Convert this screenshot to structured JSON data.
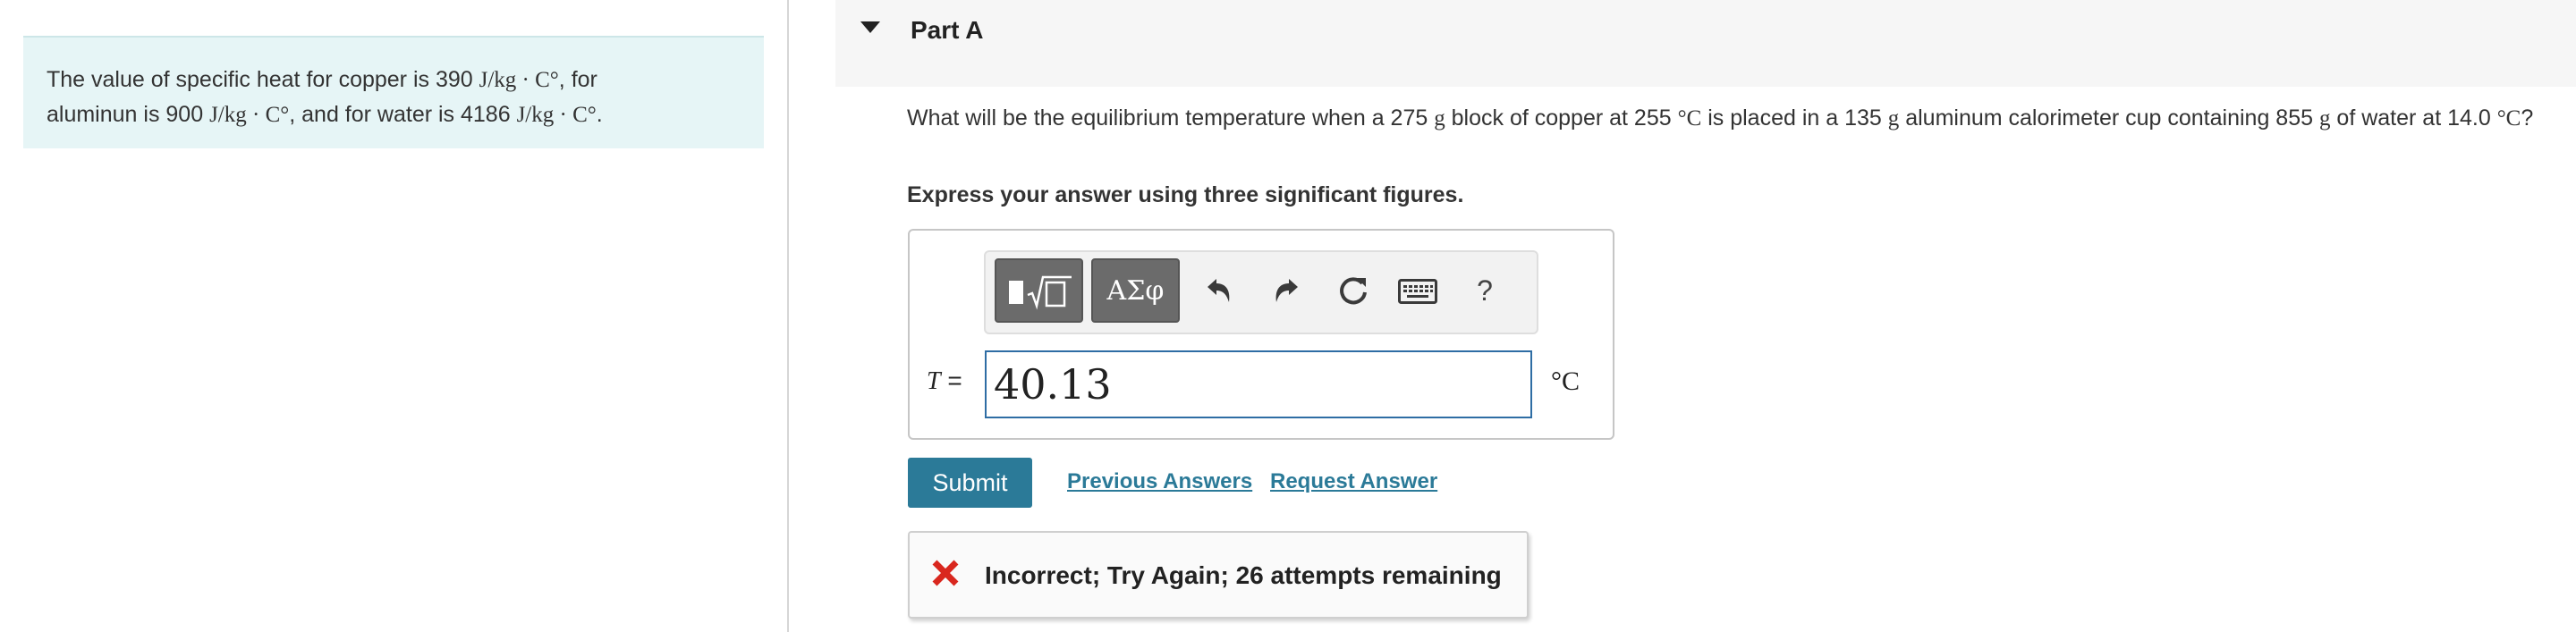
{
  "info": {
    "text_1": "The value of specific heat for copper is 390 ",
    "unit_jkgc": "J/kg · C°",
    "text_2": ", for",
    "text_3": "aluminun is 900 ",
    "text_4": ", and for water is 4186 ",
    "text_5": "."
  },
  "part": {
    "title": "Part A"
  },
  "question": {
    "text_1": "What will be the equilibrium temperature when a 275 ",
    "g": "g",
    "text_2": " block of copper at 255 ",
    "deg_c": "°C",
    "text_3": " is placed in a 135 ",
    "text_4": " aluminum calorimeter cup containing 855 ",
    "text_5": " of water at 14.0 ",
    "text_6": "?"
  },
  "instruction": "Express your answer using three significant figures.",
  "toolbar": {
    "greek_label": "ΑΣφ",
    "help_label": "?",
    "icons": [
      "templates-icon",
      "greek-letters-icon",
      "undo-icon",
      "redo-icon",
      "reset-icon",
      "keyboard-icon",
      "help-icon"
    ]
  },
  "answer": {
    "variable": "T",
    "equals": "=",
    "value": "40.13",
    "unit": "°C"
  },
  "actions": {
    "submit_label": "Submit",
    "previous_answers_label": "Previous Answers",
    "request_answer_label": "Request Answer"
  },
  "feedback": {
    "text": "Incorrect; Try Again; 26 attempts remaining",
    "status_color": "#d9271e"
  },
  "colors": {
    "accent": "#2b7a98",
    "info_background": "#e6f5f6",
    "input_border": "#2e6da4"
  }
}
